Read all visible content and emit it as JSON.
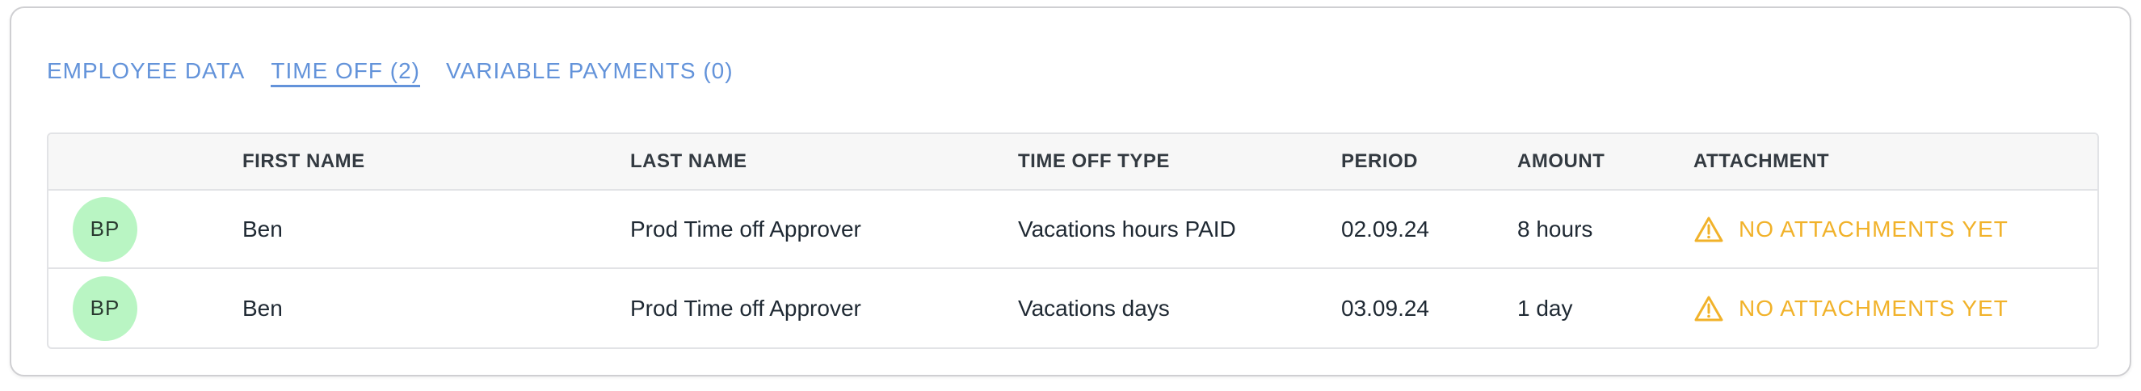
{
  "tabs": [
    {
      "label": "EMPLOYEE DATA",
      "active": false
    },
    {
      "label": "TIME OFF (2)",
      "active": true
    },
    {
      "label": "VARIABLE PAYMENTS (0)",
      "active": false
    }
  ],
  "table": {
    "headers": [
      "",
      "FIRST NAME",
      "LAST NAME",
      "TIME OFF TYPE",
      "PERIOD",
      "AMOUNT",
      "ATTACHMENT"
    ],
    "rows": [
      {
        "initials": "BP",
        "first_name": "Ben",
        "last_name": "Prod Time off Approver",
        "type": "Vacations hours PAID",
        "period": "02.09.24",
        "amount": "8 hours",
        "attachment": "NO ATTACHMENTS YET",
        "attachment_icon": "warning-icon"
      },
      {
        "initials": "BP",
        "first_name": "Ben",
        "last_name": "Prod Time off Approver",
        "type": "Vacations days",
        "period": "03.09.24",
        "amount": "1 day",
        "attachment": "NO ATTACHMENTS YET",
        "attachment_icon": "warning-icon"
      }
    ]
  },
  "colors": {
    "tab_accent": "#6393da",
    "avatar_bg": "#b9f5c3",
    "warning": "#f1b22a"
  }
}
